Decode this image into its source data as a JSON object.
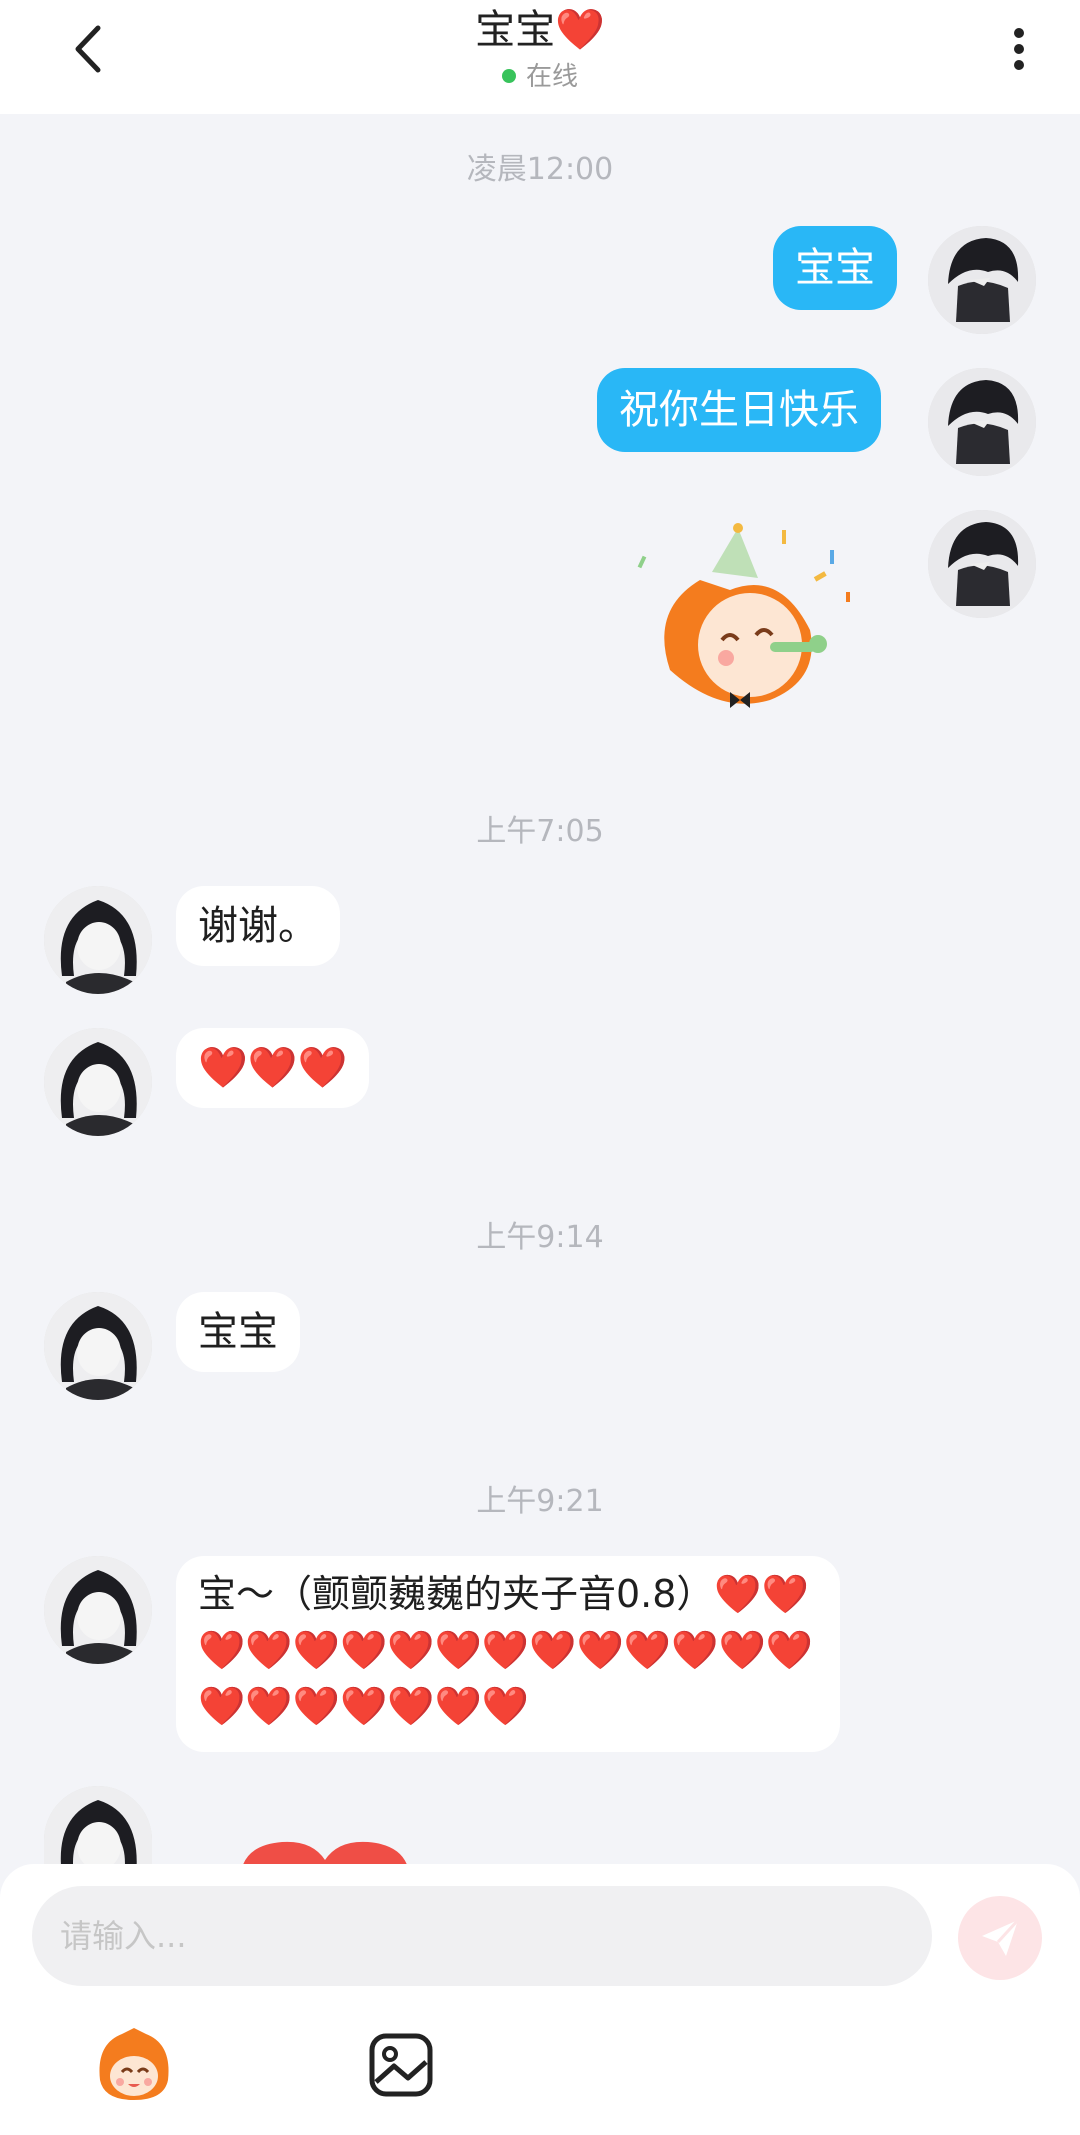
{
  "header": {
    "title": "宝宝❤️",
    "status": "在线"
  },
  "messages": {
    "ts1": "凌晨12:00",
    "m1": "宝宝",
    "m2": "祝你生日快乐",
    "ts2": "上午7:05",
    "m3": "谢谢。",
    "m4": "❤️❤️❤️",
    "ts3": "上午9:14",
    "m5": "宝宝",
    "ts4": "上午9:21",
    "m6": "宝～（颤颤巍巍的夹子音0.8）❤️❤️❤️❤️❤️❤️❤️❤️❤️❤️❤️❤️❤️❤️❤️❤️❤️❤️❤️❤️❤️❤️"
  },
  "composer": {
    "placeholder": "请输入..."
  },
  "colors": {
    "outgoing_bubble": "#29b7f6",
    "incoming_bubble": "#ffffff",
    "online_dot": "#38c35b",
    "send_button": "#fde4e6",
    "background": "#f3f4f8"
  },
  "icons": [
    "back-arrow-icon",
    "more-vertical-icon",
    "send-plane-icon",
    "emoji-sticker-icon",
    "image-gallery-icon"
  ]
}
